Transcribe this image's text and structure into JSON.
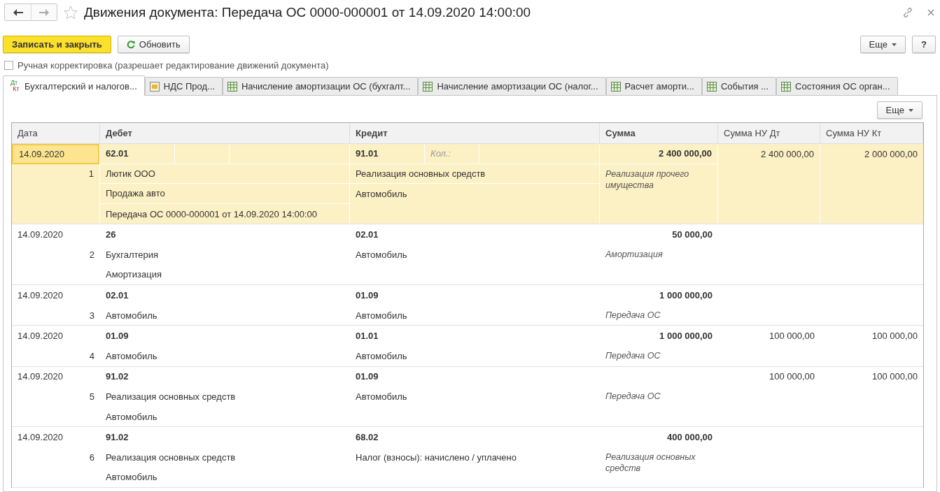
{
  "window": {
    "title": "Движения документа: Передача ОС 0000-000001 от 14.09.2020 14:00:00",
    "favorite": false
  },
  "toolbar": {
    "primary": "Записать и закрыть",
    "refresh": "Обновить",
    "more": "Еще",
    "help": "?"
  },
  "manual_edit": {
    "label": "Ручная корректировка (разрешает редактирование движений документа)",
    "checked": false
  },
  "tabs": [
    {
      "label": "Бухгалтерский и налогов...",
      "kind": "accounting",
      "icon_text": [
        "Дт",
        "Кт"
      ],
      "selected": true
    },
    {
      "label": "НДС Прод...",
      "kind": "vat",
      "selected": false
    },
    {
      "label": "Начисление амортизации ОС (бухгалт...",
      "kind": "register",
      "selected": false
    },
    {
      "label": "Начисление амортизации ОС (налог...",
      "kind": "register",
      "selected": false
    },
    {
      "label": "Расчет аморти...",
      "kind": "register",
      "selected": false
    },
    {
      "label": "События ...",
      "kind": "register",
      "selected": false
    },
    {
      "label": "Состояния ОС орган...",
      "kind": "register",
      "selected": false
    }
  ],
  "table": {
    "more": "Еще",
    "columns": [
      "Дата",
      "Дебет",
      "Кредит",
      "Сумма",
      "Сумма НУ Дт",
      "Сумма НУ Кт"
    ],
    "rows": [
      {
        "selected": true,
        "date": "14.09.2020",
        "number": "1",
        "debit": [
          "62.01",
          "Лютик ООО",
          "Продажа авто",
          "Передача ОС 0000-000001 от 14.09.2020 14:00:00"
        ],
        "credit": [
          "91.01",
          "Реализация основных средств",
          "Автомобиль"
        ],
        "credit_qty_label": "Кол.:",
        "amount": "2 400 000,00",
        "content": "Реализация прочего имущества",
        "nu_dt": "2 400 000,00",
        "nu_kt": "2 000 000,00"
      },
      {
        "selected": false,
        "date": "14.09.2020",
        "number": "2",
        "debit": [
          "26",
          "Бухгалтерия",
          "Амортизация"
        ],
        "credit": [
          "02.01",
          "Автомобиль"
        ],
        "amount": "50 000,00",
        "content": "Амортизация"
      },
      {
        "selected": false,
        "date": "14.09.2020",
        "number": "3",
        "debit": [
          "02.01",
          "Автомобиль"
        ],
        "credit": [
          "01.09",
          "Автомобиль"
        ],
        "amount": "1 000 000,00",
        "content": "Передача ОС"
      },
      {
        "selected": false,
        "date": "14.09.2020",
        "number": "4",
        "debit": [
          "01.09",
          "Автомобиль"
        ],
        "credit": [
          "01.01",
          "Автомобиль"
        ],
        "amount": "1 000 000,00",
        "content": "Передача ОС",
        "nu_dt": "100 000,00",
        "nu_kt": "100 000,00"
      },
      {
        "selected": false,
        "date": "14.09.2020",
        "number": "5",
        "debit": [
          "91.02",
          "Реализация основных средств",
          "Автомобиль"
        ],
        "credit": [
          "01.09",
          "Автомобиль"
        ],
        "content": "Передача ОС",
        "nu_dt": "100 000,00",
        "nu_kt": "100 000,00"
      },
      {
        "selected": false,
        "date": "14.09.2020",
        "number": "6",
        "debit": [
          "91.02",
          "Реализация основных средств",
          "Автомобиль"
        ],
        "credit": [
          "68.02",
          "Налог (взносы): начислено / уплачено"
        ],
        "amount": "400 000,00",
        "content": "Реализация основных средств"
      }
    ]
  }
}
